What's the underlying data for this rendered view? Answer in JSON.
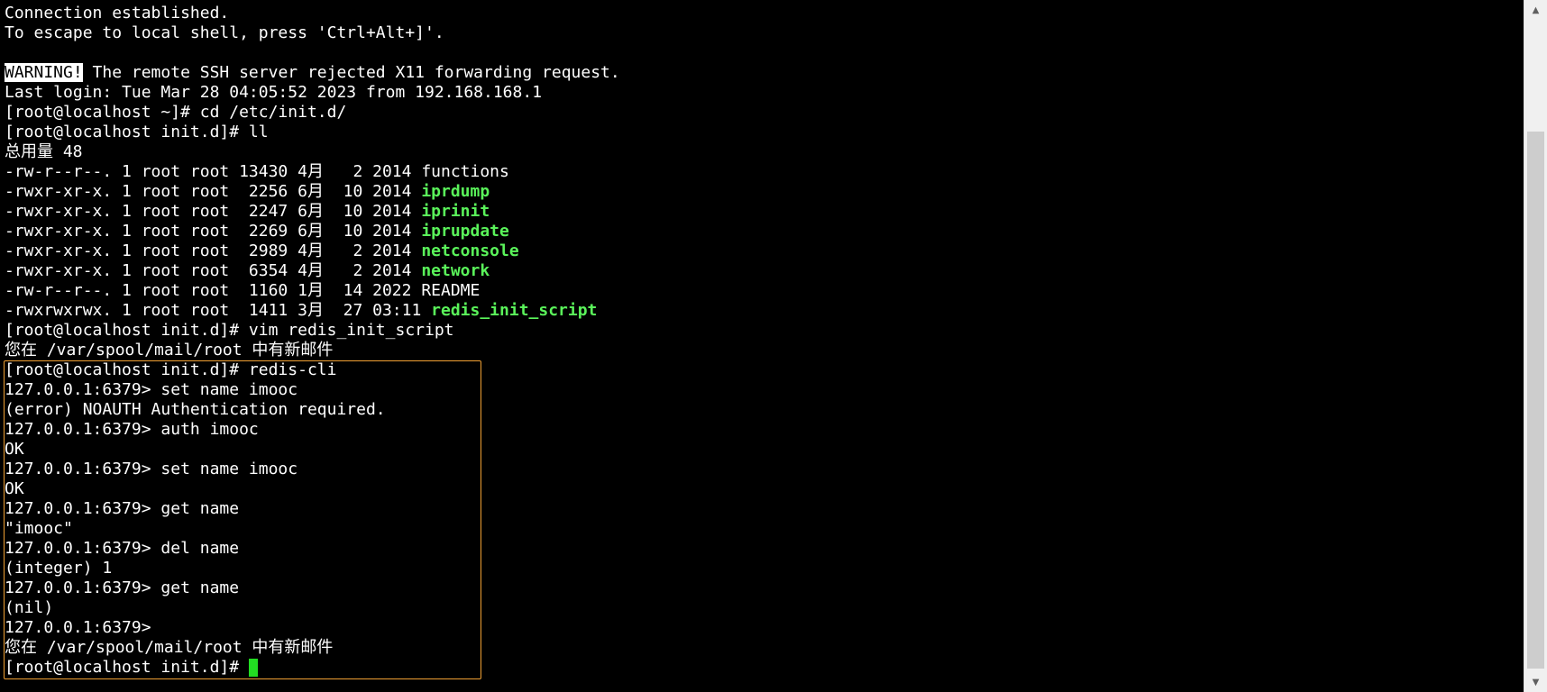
{
  "terminal": {
    "lines": [
      {
        "text": "Connection established."
      },
      {
        "text": "To escape to local shell, press 'Ctrl+Alt+]'."
      },
      {
        "text": ""
      },
      {
        "warning_label": "WARNING!",
        "text": " The remote SSH server rejected X11 forwarding request."
      },
      {
        "text": "Last login: Tue Mar 28 04:05:52 2023 from 192.168.168.1"
      },
      {
        "text": "[root@localhost ~]# cd /etc/init.d/"
      },
      {
        "text": "[root@localhost init.d]# ll"
      },
      {
        "text": "总用量 48"
      },
      {
        "text": "-rw-r--r--. 1 root root 13430 4月   2 2014 ",
        "file": "functions",
        "exec": false
      },
      {
        "text": "-rwxr-xr-x. 1 root root  2256 6月  10 2014 ",
        "file": "iprdump",
        "exec": true
      },
      {
        "text": "-rwxr-xr-x. 1 root root  2247 6月  10 2014 ",
        "file": "iprinit",
        "exec": true
      },
      {
        "text": "-rwxr-xr-x. 1 root root  2269 6月  10 2014 ",
        "file": "iprupdate",
        "exec": true
      },
      {
        "text": "-rwxr-xr-x. 1 root root  2989 4月   2 2014 ",
        "file": "netconsole",
        "exec": true
      },
      {
        "text": "-rwxr-xr-x. 1 root root  6354 4月   2 2014 ",
        "file": "network",
        "exec": true
      },
      {
        "text": "-rw-r--r--. 1 root root  1160 1月  14 2022 ",
        "file": "README",
        "exec": false
      },
      {
        "text": "-rwxrwxrwx. 1 root root  1411 3月  27 03:11 ",
        "file": "redis_init_script",
        "exec": true
      },
      {
        "text": "[root@localhost init.d]# vim redis_init_script"
      },
      {
        "text": "您在 /var/spool/mail/root 中有新邮件"
      },
      {
        "text": "[root@localhost init.d]# redis-cli"
      },
      {
        "text": "127.0.0.1:6379> set name imooc"
      },
      {
        "text": "(error) NOAUTH Authentication required."
      },
      {
        "text": "127.0.0.1:6379> auth imooc"
      },
      {
        "text": "OK"
      },
      {
        "text": "127.0.0.1:6379> set name imooc"
      },
      {
        "text": "OK"
      },
      {
        "text": "127.0.0.1:6379> get name"
      },
      {
        "text": "\"imooc\""
      },
      {
        "text": "127.0.0.1:6379> del name"
      },
      {
        "text": "(integer) 1"
      },
      {
        "text": "127.0.0.1:6379> get name"
      },
      {
        "text": "(nil)"
      },
      {
        "text": "127.0.0.1:6379>"
      },
      {
        "text": "您在 /var/spool/mail/root 中有新邮件"
      },
      {
        "text": "[root@localhost init.d]# ",
        "cursor": true
      }
    ]
  },
  "scrollbar": {
    "up_icon": "▲",
    "down_icon": "▼"
  },
  "colors": {
    "background": "#000000",
    "foreground": "#ffffff",
    "executable": "#5af35a",
    "cursor": "#22dd22",
    "highlight_border": "#f0a033"
  }
}
